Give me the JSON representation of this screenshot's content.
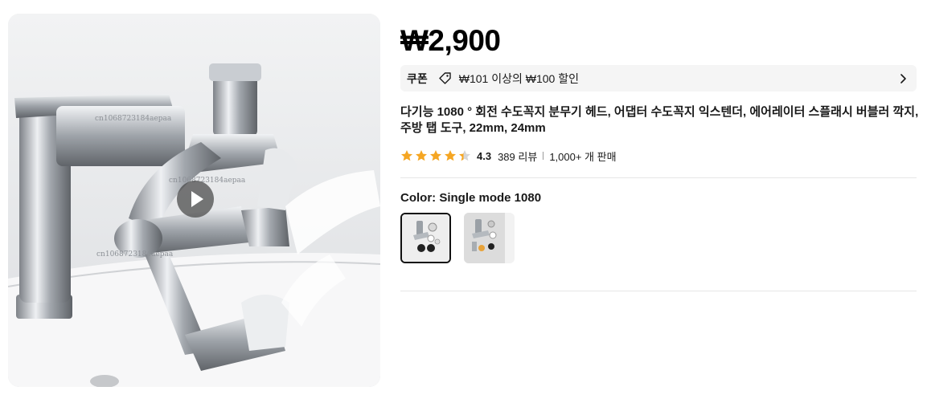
{
  "product": {
    "image_watermark": "cn1068723184aepaa",
    "video_icon": "play-icon",
    "price": "₩2,900",
    "coupon": {
      "label": "쿠폰",
      "icon": "tag-icon",
      "text": "₩101 이상의 ₩100 할인",
      "chevron": "chevron-right-icon"
    },
    "title_lines": [
      "다기능 1080 ° 회전 수도꼭지 분무기 헤드, 어댑터 수도꼭지 익스텐더, 에어레이터 스플래시 버블러 깍지,",
      "주방 탭 도구, 22mm, 24mm"
    ],
    "rating": {
      "value": "4.3",
      "stars": 4.3,
      "star_color": "#f5a623",
      "reviews": "389 리뷰",
      "sold": "1,000+ 개 판매"
    },
    "color": {
      "label": "Color: Single mode 1080",
      "swatches": [
        {
          "name": "Single mode 1080",
          "selected": true
        },
        {
          "name": "Option 2",
          "selected": false
        }
      ]
    }
  }
}
